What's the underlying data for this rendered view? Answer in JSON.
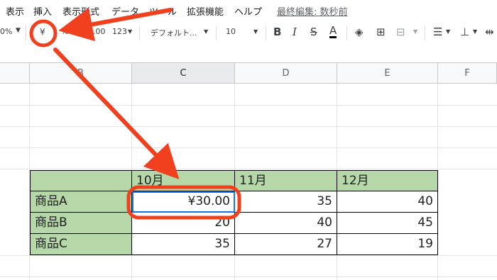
{
  "menu": {
    "items": [
      "表示",
      "挿入",
      "表示形式",
      "データ",
      "ツール",
      "拡張機能",
      "ヘルプ"
    ],
    "last_edit": "最終編集: 数秒前"
  },
  "toolbar": {
    "zoom": "0%",
    "currency": "¥",
    "percent": "%",
    "decimal_decrease": ".0",
    "decimal_increase": ".00",
    "more_formats": "123",
    "font": "デフォルト...",
    "font_size": "10"
  },
  "columns": [
    "B",
    "C",
    "D",
    "E",
    "F"
  ],
  "table": {
    "headers": [
      "",
      "10月",
      "11月",
      "12月"
    ],
    "rows": [
      {
        "label": "商品A",
        "values": [
          "¥30.00",
          "35",
          "40"
        ]
      },
      {
        "label": "商品B",
        "values": [
          "20",
          "40",
          "45"
        ]
      },
      {
        "label": "商品C",
        "values": [
          "35",
          "27",
          "19"
        ]
      }
    ]
  },
  "colors": {
    "header_fill": "#b6d7a8",
    "annotation_red": "#f0401e",
    "selection_blue": "#1a73e8"
  }
}
